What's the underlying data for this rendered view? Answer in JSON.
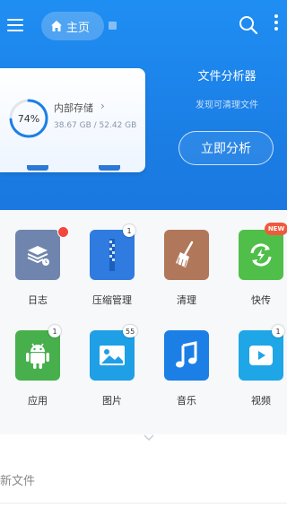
{
  "header": {
    "home_tab_label": "主页"
  },
  "storage": {
    "percent": "74%",
    "label": "内部存储",
    "size": "38.67 GB / 52.42 GB",
    "used_fraction": 0.74
  },
  "analyzer": {
    "title": "文件分析器",
    "subtitle": "发现可清理文件",
    "button_label": "立即分析"
  },
  "apps": [
    {
      "label": "日志",
      "icon": "log-icon",
      "color": "#6f85ad",
      "badge": "",
      "red_dot": true
    },
    {
      "label": "压缩管理",
      "icon": "archive-icon",
      "color": "#2f7be0",
      "badge": "1"
    },
    {
      "label": "清理",
      "icon": "broom-icon",
      "color": "#b1775a",
      "badge": ""
    },
    {
      "label": "快传",
      "icon": "transfer-icon",
      "color": "#4fbf4a",
      "badge": "NEW"
    },
    {
      "label": "应用",
      "icon": "android-icon",
      "color": "#47b04c",
      "badge": "1"
    },
    {
      "label": "图片",
      "icon": "image-icon",
      "color": "#1f9fe5",
      "badge": "55"
    },
    {
      "label": "音乐",
      "icon": "music-icon",
      "color": "#1b7fe6",
      "badge": ""
    },
    {
      "label": "视频",
      "icon": "video-icon",
      "color": "#1fa6e6",
      "badge": "1"
    }
  ],
  "section": {
    "new_files_label": "新文件"
  },
  "colors": {
    "header_blue": "#1f8ef2",
    "progress_blue": "#1b7fe6"
  }
}
